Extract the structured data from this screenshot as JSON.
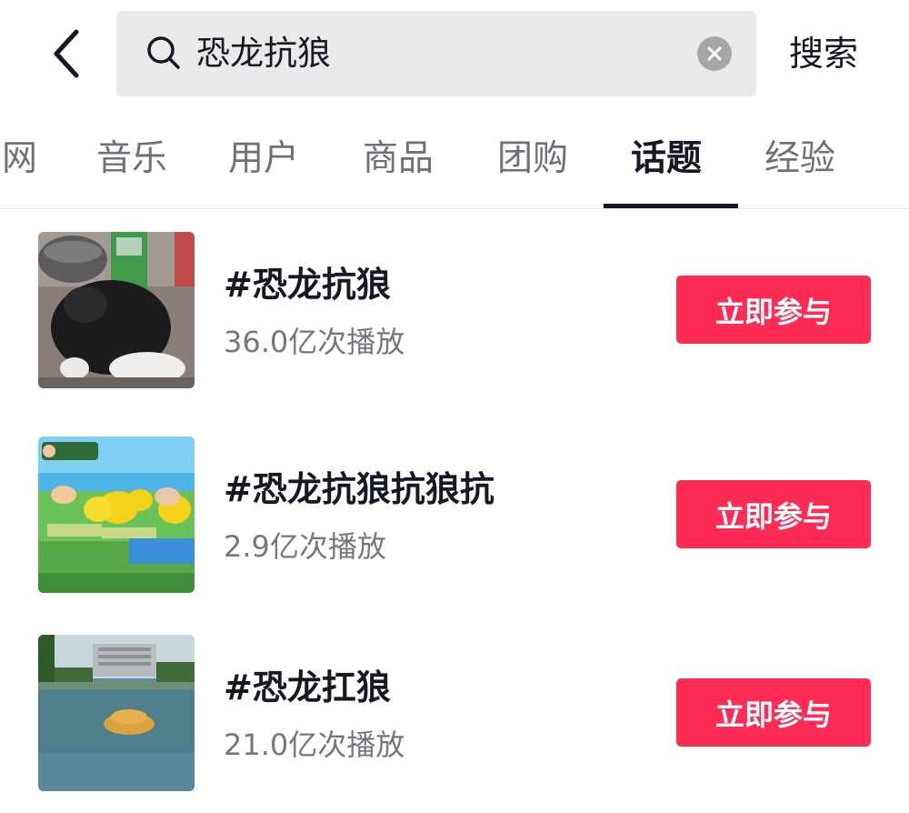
{
  "search": {
    "query": "恐龙抗狼",
    "submit_label": "搜索"
  },
  "tabs": [
    {
      "label": "网",
      "active": false
    },
    {
      "label": "音乐",
      "active": false
    },
    {
      "label": "用户",
      "active": false
    },
    {
      "label": "商品",
      "active": false
    },
    {
      "label": "团购",
      "active": false
    },
    {
      "label": "话题",
      "active": true
    },
    {
      "label": "经验",
      "active": false
    }
  ],
  "topics": [
    {
      "title": "#恐龙抗狼",
      "stats": "36.0亿次播放",
      "join_label": "立即参与",
      "thumbnail": "cat-video-thumbnail"
    },
    {
      "title": "#恐龙抗狼抗狼抗",
      "stats": "2.9亿次播放",
      "join_label": "立即参与",
      "thumbnail": "game-screenshot-thumbnail"
    },
    {
      "title": "#恐龙扛狼",
      "stats": "21.0亿次播放",
      "join_label": "立即参与",
      "thumbnail": "dragon-boat-river-thumbnail"
    }
  ],
  "icons": {
    "back": "chevron-left-icon",
    "search": "search-icon",
    "clear": "clear-icon"
  },
  "colors": {
    "accent": "#fe2c55",
    "search_bg": "#eaeaeb",
    "text_primary": "#161823",
    "text_secondary": "#76777e"
  }
}
